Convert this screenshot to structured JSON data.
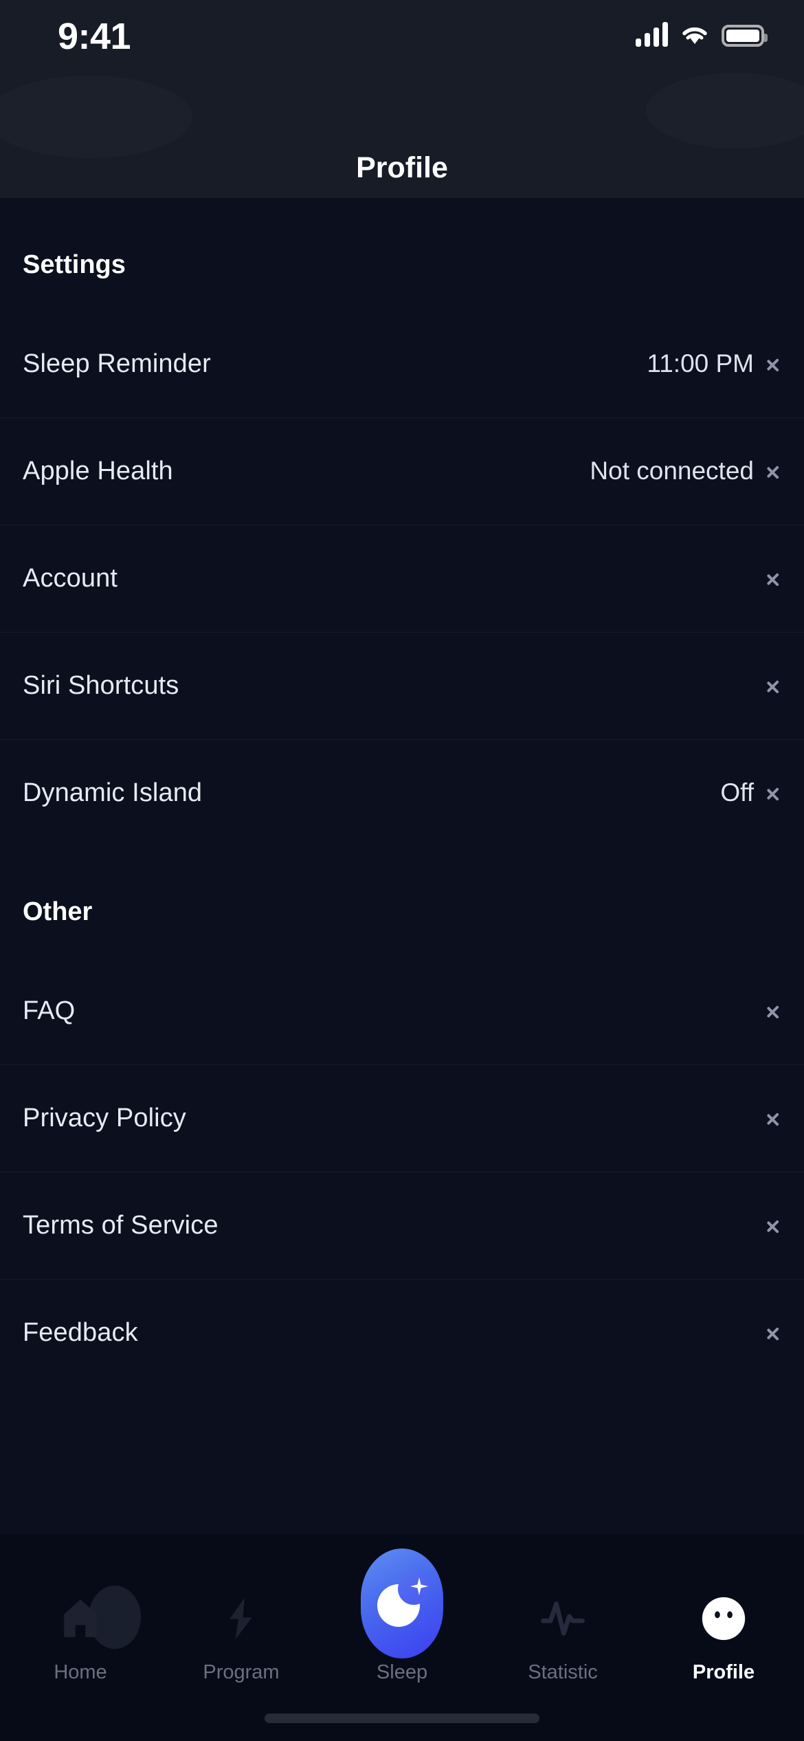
{
  "status_bar": {
    "time": "9:41",
    "signal_icon": "cellular-signal-icon",
    "wifi_icon": "wifi-icon",
    "battery_icon": "battery-full-icon"
  },
  "header": {
    "title": "Profile"
  },
  "sections": [
    {
      "id": "settings",
      "title": "Settings",
      "rows": [
        {
          "label": "Sleep Reminder",
          "value": "11:00 PM",
          "chevron": "chevron-right-icon"
        },
        {
          "label": "Apple Health",
          "value": "Not connected",
          "chevron": "chevron-right-icon"
        },
        {
          "label": "Account",
          "value": "",
          "chevron": "chevron-right-icon"
        },
        {
          "label": "Siri Shortcuts",
          "value": "",
          "chevron": "chevron-right-icon"
        },
        {
          "label": "Dynamic Island",
          "value": "Off",
          "chevron": "chevron-right-icon"
        }
      ]
    },
    {
      "id": "other",
      "title": "Other",
      "rows": [
        {
          "label": "FAQ",
          "value": "",
          "chevron": "chevron-right-icon"
        },
        {
          "label": "Privacy Policy",
          "value": "",
          "chevron": "chevron-right-icon"
        },
        {
          "label": "Terms of Service",
          "value": "",
          "chevron": "chevron-right-icon"
        },
        {
          "label": "Feedback",
          "value": "",
          "chevron": "chevron-right-icon"
        }
      ]
    }
  ],
  "tab_bar": {
    "tabs": [
      {
        "label": "Home",
        "icon": "home-icon",
        "active": false
      },
      {
        "label": "Program",
        "icon": "lightning-bolt-icon",
        "active": false
      },
      {
        "label": "Sleep",
        "icon": "moon-sparkle-icon",
        "active": false
      },
      {
        "label": "Statistic",
        "icon": "pulse-wave-icon",
        "active": false
      },
      {
        "label": "Profile",
        "icon": "face-avatar-icon",
        "active": true
      }
    ]
  },
  "colors": {
    "background": "#0b0f1e",
    "header_background": "#181c26",
    "tabbar_background": "#070b18",
    "accent_gradient_start": "#5f8ef2",
    "accent_gradient_end": "#3b3ef0",
    "text_primary": "#ffffff",
    "text_secondary": "#6b7080"
  }
}
